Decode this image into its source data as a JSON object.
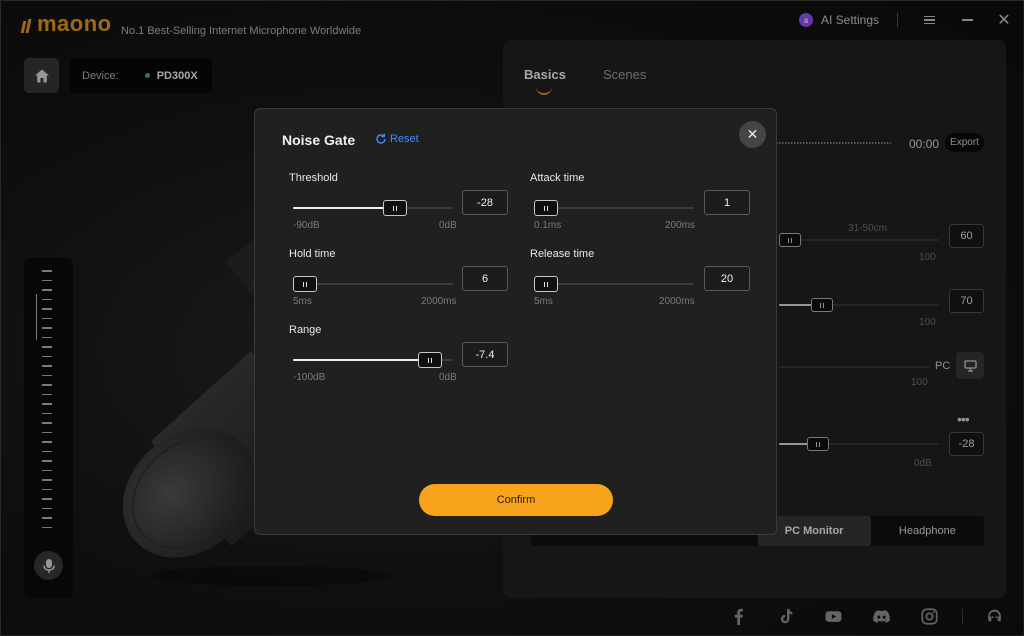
{
  "app": {
    "brand": "maono",
    "tagline": "No.1 Best-Selling Internet Microphone Worldwide",
    "ai_settings_label": "AI Settings"
  },
  "device": {
    "label": "Device:",
    "name": "PD300X",
    "status_color": "#2ecc71"
  },
  "icons": {
    "home": "home-icon",
    "mic": "microphone-icon",
    "menu": "menu-icon",
    "minimize": "minimize-icon",
    "close": "close-icon",
    "reset": "refresh-icon",
    "monitor": "monitor-icon",
    "social": [
      "facebook-icon",
      "tiktok-icon",
      "youtube-icon",
      "discord-icon",
      "instagram-icon",
      "support-icon"
    ]
  },
  "colors": {
    "accent": "#f5a21e",
    "link": "#3d8bff"
  },
  "right_panel": {
    "tabs": [
      "Basics",
      "Scenes"
    ],
    "active_tab": "Basics",
    "time": "00:00",
    "export_label": "Export",
    "distance_label": "31-50cm",
    "slider1": {
      "value": "60",
      "max": "100"
    },
    "slider2": {
      "value": "70",
      "max": "100"
    },
    "pc_label": "PC",
    "pc_max": "100",
    "slider3": {
      "value": "-28",
      "max": "0dB"
    },
    "monitor_tabs": [
      {
        "label": "PC Monitor",
        "active": true
      },
      {
        "label": "Headphone",
        "active": false
      }
    ]
  },
  "dialog": {
    "title": "Noise Gate",
    "reset_label": "Reset",
    "confirm_label": "Confirm",
    "params": {
      "threshold": {
        "label": "Threshold",
        "value": "-28",
        "min": "-90dB",
        "max": "0dB",
        "level": 0.66
      },
      "attack": {
        "label": "Attack time",
        "value": "1",
        "min": "0.1ms",
        "max": "200ms",
        "level": 0.0
      },
      "hold": {
        "label": "Hold time",
        "value": "6",
        "min": "5ms",
        "max": "2000ms",
        "level": 0.0
      },
      "release": {
        "label": "Release time",
        "value": "20",
        "min": "5ms",
        "max": "2000ms",
        "level": 0.0
      },
      "range": {
        "label": "Range",
        "value": "-7.4",
        "min": "-100dB",
        "max": "0dB",
        "level": 0.92
      }
    }
  }
}
